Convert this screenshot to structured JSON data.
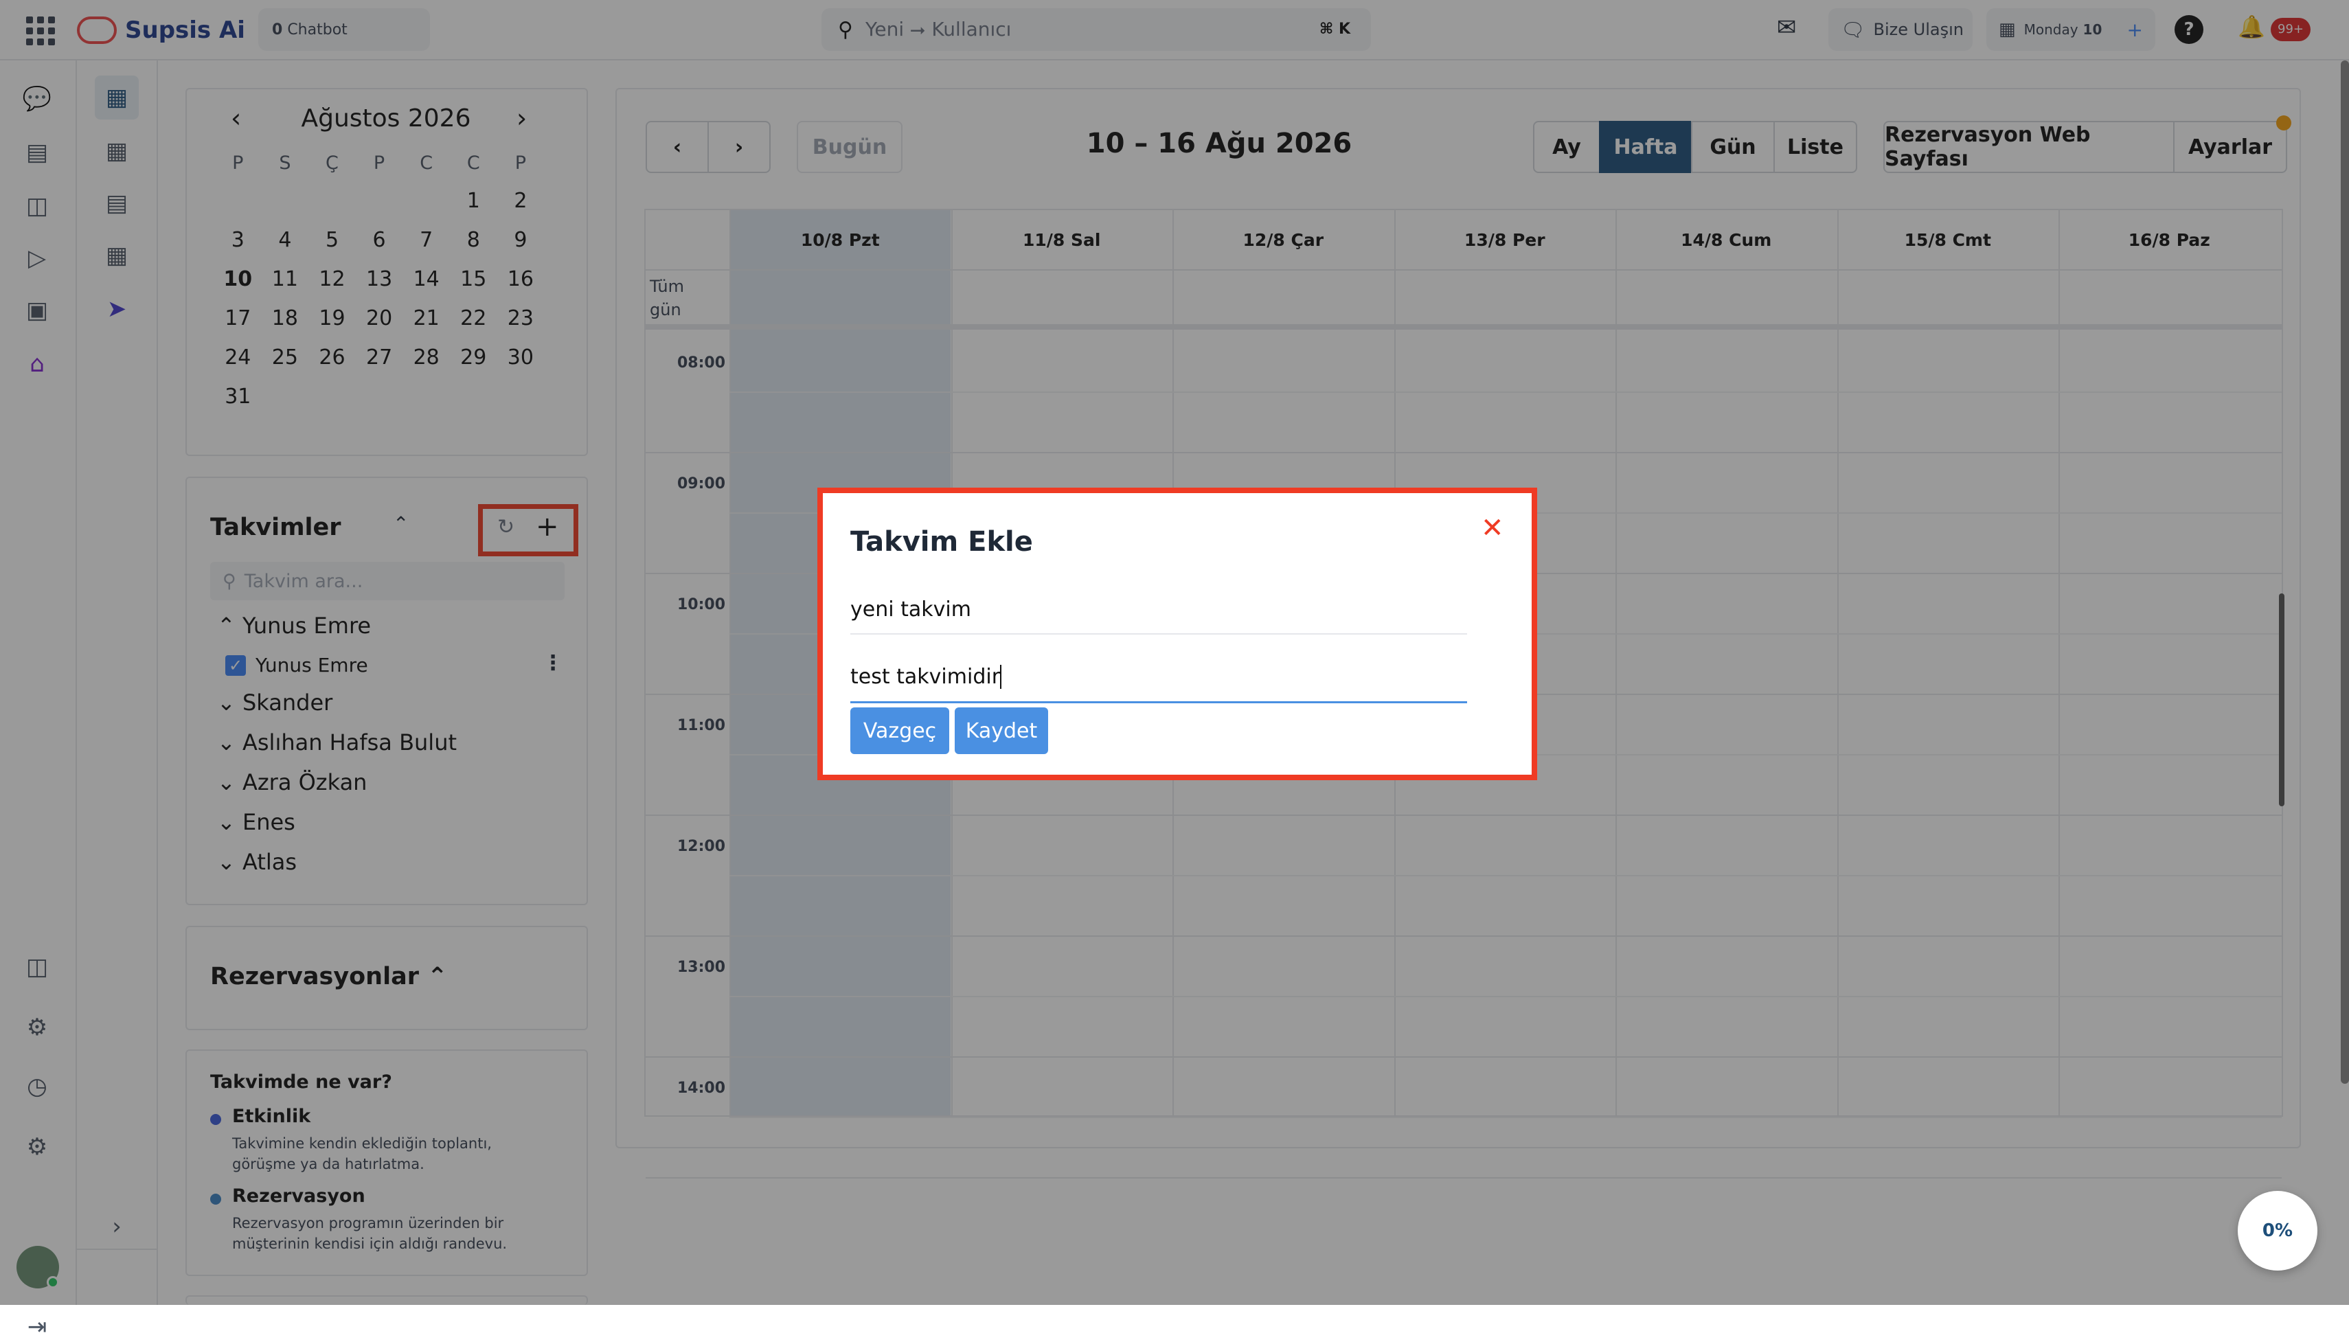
{
  "topbar": {
    "brand": "Supsis Ai",
    "chatbot_count": "0",
    "chatbot_label": "Chatbot",
    "search_placeholder": "Yeni ⭢ Kullanıcı",
    "shortcut": "⌘ K",
    "contact_label": "Bize Ulaşın",
    "day_label": "Monday",
    "day_number": "10",
    "notification_badge": "99+"
  },
  "mini_calendar": {
    "month": "Ağustos 2026",
    "weekdays": [
      "P",
      "S",
      "Ç",
      "P",
      "C",
      "C",
      "P"
    ],
    "weeks": [
      [
        "",
        "",
        "",
        "",
        "",
        "1",
        "2"
      ],
      [
        "3",
        "4",
        "5",
        "6",
        "7",
        "8",
        "9"
      ],
      [
        "10",
        "11",
        "12",
        "13",
        "14",
        "15",
        "16"
      ],
      [
        "17",
        "18",
        "19",
        "20",
        "21",
        "22",
        "23"
      ],
      [
        "24",
        "25",
        "26",
        "27",
        "28",
        "29",
        "30"
      ],
      [
        "31",
        "",
        "",
        "",
        "",
        "",
        ""
      ]
    ]
  },
  "calendars": {
    "title": "Takvimler",
    "search_placeholder": "Takvim ara...",
    "groups": [
      {
        "name": "Yunus Emre",
        "expanded": true,
        "items": [
          "Yunus Emre"
        ]
      },
      {
        "name": "Skander"
      },
      {
        "name": "Aslıhan Hafsa Bulut"
      },
      {
        "name": "Azra Özkan"
      },
      {
        "name": "Enes"
      },
      {
        "name": "Atlas"
      }
    ]
  },
  "reservations": {
    "title": "Rezervasyonlar"
  },
  "info": {
    "title": "Takvimde ne var?",
    "event_title": "Etkinlik",
    "event_desc": "Takvimine kendin eklediğin toplantı, görüşme ya da hatırlatma.",
    "reservation_title": "Rezervasyon",
    "reservation_desc": "Rezervasyon programın üzerinden bir müşterinin kendisi için aldığı randevu."
  },
  "main": {
    "today_label": "Bugün",
    "range_title": "10 – 16 Ağu 2026",
    "view_month": "Ay",
    "view_week": "Hafta",
    "view_day": "Gün",
    "view_list": "Liste",
    "booking_page": "Rezervasyon Web Sayfası",
    "settings": "Ayarlar",
    "all_day": "Tüm gün",
    "days": [
      "10/8 Pzt",
      "11/8 Sal",
      "12/8 Çar",
      "13/8 Per",
      "14/8 Cum",
      "15/8 Cmt",
      "16/8 Paz"
    ],
    "times": [
      "08:00",
      "09:00",
      "10:00",
      "11:00",
      "12:00",
      "13:00",
      "14:00"
    ]
  },
  "dialog": {
    "title": "Takvim Ekle",
    "name_value": "yeni takvim",
    "desc_value": "test takvimidir",
    "cancel": "Vazgeç",
    "save": "Kaydet"
  },
  "progress": {
    "label": "0%"
  },
  "colors": {
    "accent": "#1e4f7a",
    "button": "#4a90e2",
    "highlight": "#ef3b24"
  }
}
